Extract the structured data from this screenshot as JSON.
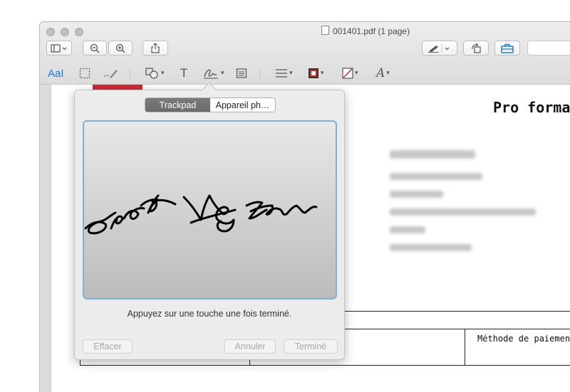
{
  "window": {
    "title": "001401.pdf (1 page)",
    "accent_color": "#7fb0db"
  },
  "toolbar": {
    "icons": [
      "sidebar-icon",
      "zoom-out-icon",
      "zoom-in-icon",
      "share-icon",
      "pen-icon",
      "rotate-icon",
      "toolbox-icon"
    ]
  },
  "markup_toolbar": {
    "text_style_label": "AaI",
    "text_tool_label": "T",
    "font_label": "A"
  },
  "document": {
    "heading": "Pro forma",
    "payment_label": "Méthode de paiemen"
  },
  "signature_popover": {
    "tabs": [
      {
        "label": "Trackpad",
        "selected": true
      },
      {
        "label": "Appareil ph…",
        "selected": false
      }
    ],
    "instruction": "Appuyez sur une touche une fois terminé.",
    "buttons": {
      "clear": "Effacer",
      "cancel": "Annuler",
      "done": "Terminé"
    }
  }
}
